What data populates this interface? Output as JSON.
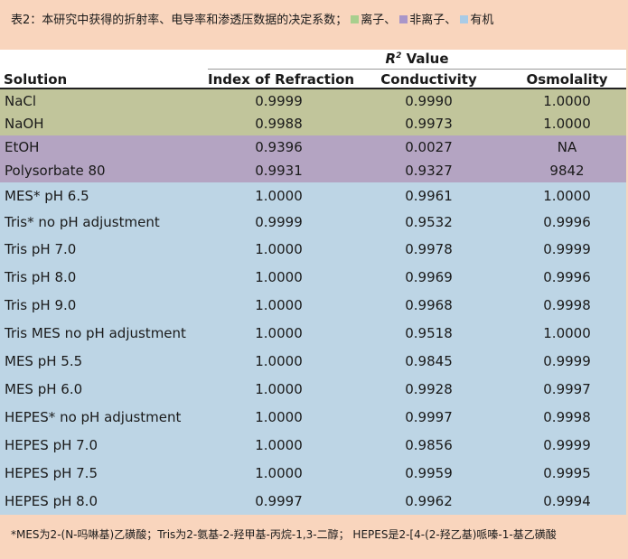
{
  "caption": {
    "text": "表2：本研究中获得的折射率、电导率和渗透压数据的决定系数；",
    "legend": [
      {
        "label": "离子、",
        "color": "#a8cf8e"
      },
      {
        "label": "非离子、",
        "color": "#a996c9"
      },
      {
        "label": "有机",
        "color": "#a9cbe6"
      }
    ]
  },
  "table": {
    "group_header_prefix": "R",
    "group_header_sup": "2",
    "group_header_suffix": " Value",
    "columns": [
      "Solution",
      "Index of Refraction",
      "Conductivity",
      "Osmolality"
    ],
    "rows": [
      {
        "name": "NaCl",
        "refraction": "0.9999",
        "conductivity": "0.9990",
        "osmolality": "1.0000",
        "group": "ionic"
      },
      {
        "name": "NaOH",
        "refraction": "0.9988",
        "conductivity": "0.9973",
        "osmolality": "1.0000",
        "group": "ionic"
      },
      {
        "name": "EtOH",
        "refraction": "0.9396",
        "conductivity": "0.0027",
        "osmolality": "NA",
        "group": "nonionic"
      },
      {
        "name": "Polysorbate 80",
        "refraction": "0.9931",
        "conductivity": "0.9327",
        "osmolality": "9842",
        "group": "nonionic"
      },
      {
        "name": "MES* pH 6.5",
        "refraction": "1.0000",
        "conductivity": "0.9961",
        "osmolality": "1.0000",
        "group": "organic"
      },
      {
        "name": "Tris* no pH adjustment",
        "refraction": "0.9999",
        "conductivity": "0.9532",
        "osmolality": "0.9996",
        "group": "organic"
      },
      {
        "name": "Tris pH 7.0",
        "refraction": "1.0000",
        "conductivity": "0.9978",
        "osmolality": "0.9999",
        "group": "organic"
      },
      {
        "name": "Tris pH 8.0",
        "refraction": "1.0000",
        "conductivity": "0.9969",
        "osmolality": "0.9996",
        "group": "organic"
      },
      {
        "name": "Tris pH 9.0",
        "refraction": "1.0000",
        "conductivity": "0.9968",
        "osmolality": "0.9998",
        "group": "organic"
      },
      {
        "name": "Tris MES no pH adjustment",
        "refraction": "1.0000",
        "conductivity": "0.9518",
        "osmolality": "1.0000",
        "group": "organic"
      },
      {
        "name": "MES pH 5.5",
        "refraction": "1.0000",
        "conductivity": "0.9845",
        "osmolality": "0.9999",
        "group": "organic"
      },
      {
        "name": "MES pH 6.0",
        "refraction": "1.0000",
        "conductivity": "0.9928",
        "osmolality": "0.9997",
        "group": "organic"
      },
      {
        "name": "HEPES* no pH adjustment",
        "refraction": "1.0000",
        "conductivity": "0.9997",
        "osmolality": "0.9998",
        "group": "organic"
      },
      {
        "name": "HEPES pH 7.0",
        "refraction": "1.0000",
        "conductivity": "0.9856",
        "osmolality": "0.9999",
        "group": "organic"
      },
      {
        "name": "HEPES pH 7.5",
        "refraction": "1.0000",
        "conductivity": "0.9959",
        "osmolality": "0.9995",
        "group": "organic"
      },
      {
        "name": "HEPES pH 8.0",
        "refraction": "0.9997",
        "conductivity": "0.9962",
        "osmolality": "0.9994",
        "group": "organic"
      }
    ]
  },
  "footnote": "*MES为2-(N-吗啉基)乙磺酸；Tris为2-氨基-2-羟甲基-丙烷-1,3-二醇； HEPES是2-[4-(2-羟乙基)哌嗪-1-基乙磺酸",
  "colors": {
    "page_background": "#f9d5bd",
    "ionic_row": "#c1c59b",
    "nonionic_row": "#b4a4c2",
    "organic_row": "#bdd5e5"
  }
}
